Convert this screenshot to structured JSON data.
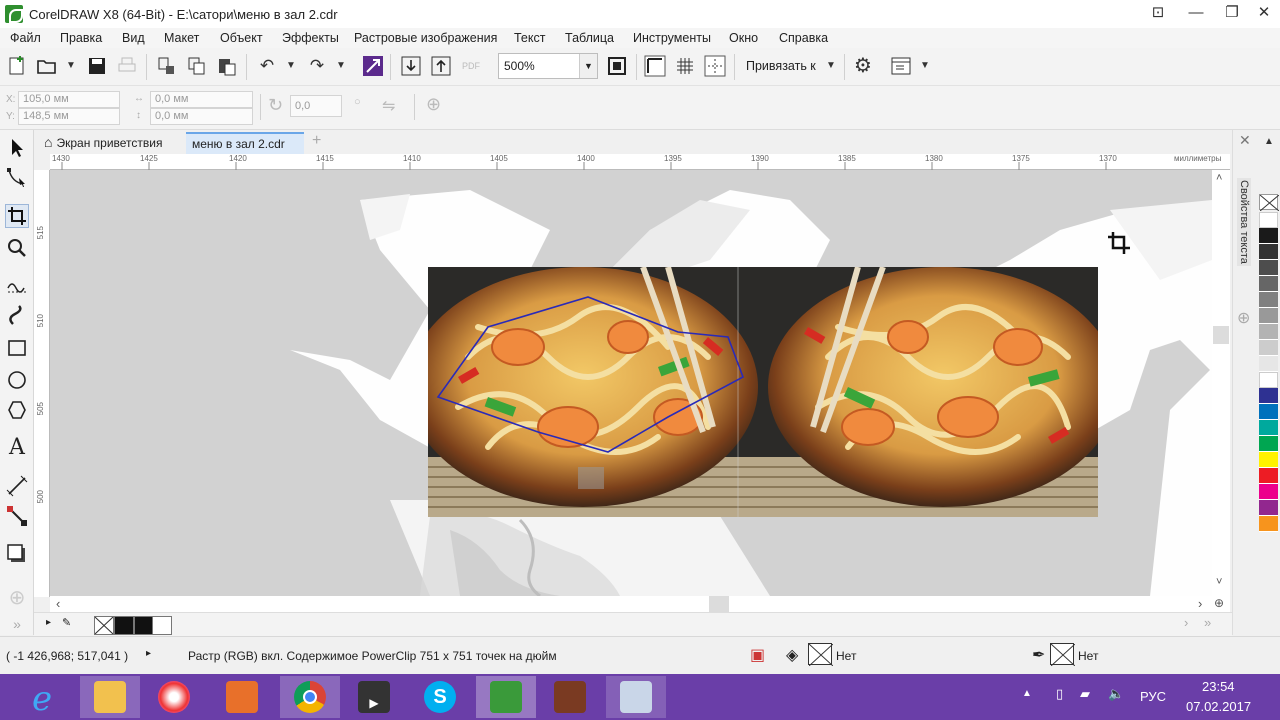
{
  "window": {
    "title": "CorelDRAW X8 (64-Bit) - E:\\сатори\\меню в зал 2.cdr"
  },
  "menu": [
    "Файл",
    "Правка",
    "Вид",
    "Макет",
    "Объект",
    "Эффекты",
    "Растровые изображения",
    "Текст",
    "Таблица",
    "Инструменты",
    "Окно",
    "Справка"
  ],
  "toolbar": {
    "zoom_value": "500%",
    "snap_label": "Привязать к",
    "pdf_label": "PDF"
  },
  "property_bar": {
    "x_label": "X:",
    "y_label": "Y:",
    "x_value": "105,0 мм",
    "y_value": "148,5 мм",
    "w_value": "0,0 мм",
    "h_value": "0,0 мм",
    "rotation_value": "0,0"
  },
  "tabs": {
    "welcome": "Экран приветствия",
    "document": "меню в зал 2.cdr"
  },
  "ruler": {
    "ticks": [
      "1430",
      "1425",
      "1420",
      "1415",
      "1410",
      "1405",
      "1400",
      "1395",
      "1390",
      "1385",
      "1380",
      "1375",
      "1370"
    ],
    "unit": "миллиметры",
    "vticks": [
      "515",
      "510",
      "505",
      "500"
    ]
  },
  "docker": {
    "label": "Свойства текста"
  },
  "palette": {
    "colors": [
      "#ffffff",
      "#1a1a1a",
      "#333333",
      "#4d4d4d",
      "#666666",
      "#808080",
      "#999999",
      "#b3b3b3",
      "#cccccc",
      "#e6e6e6",
      "#ffffff",
      "#2e3192",
      "#0071bc",
      "#00a99d",
      "#00a651",
      "#fff200",
      "#ed1c24",
      "#ec008c",
      "#92278f",
      "#f7941d"
    ]
  },
  "status": {
    "coords": "( -1 426,968; 517,041 )",
    "object_info": "Растр (RGB) вкл. Содержимое PowerClip 751 x 751 точек на дюйм",
    "fill_label": "Нет",
    "outline_label": "Нет"
  },
  "taskbar": {
    "language": "РУС",
    "time": "23:54",
    "date": "07.02.2017"
  }
}
